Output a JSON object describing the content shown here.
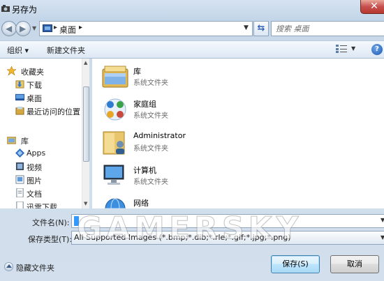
{
  "window": {
    "title": "另存为",
    "close_glyph": "✕"
  },
  "address": {
    "location": "桌面",
    "search_placeholder": "搜索 桌面"
  },
  "toolbar": {
    "organize": "组织 ▾",
    "new_folder": "新建文件夹",
    "help": "?"
  },
  "sidebar": {
    "favorites_header": "收藏夹",
    "favorites": [
      "下载",
      "桌面",
      "最近访问的位置"
    ],
    "libraries_header": "库",
    "libraries": [
      "Apps",
      "视频",
      "图片",
      "文档",
      "迅雷下载"
    ]
  },
  "files": [
    {
      "name": "库",
      "type": "系统文件夹",
      "icon": "library-folder-icon"
    },
    {
      "name": "家庭组",
      "type": "系统文件夹",
      "icon": "homegroup-icon"
    },
    {
      "name": "Administrator",
      "type": "系统文件夹",
      "icon": "user-folder-icon"
    },
    {
      "name": "计算机",
      "type": "系统文件夹",
      "icon": "computer-icon"
    },
    {
      "name": "网络",
      "type": "",
      "icon": "network-icon"
    }
  ],
  "form": {
    "filename_label": "文件名(N):",
    "filetype_label": "保存类型(T):",
    "filetype_value": "All Supported Images (*.bmp;*.dib;*.rle;*.gif;*.jpg;*.png)"
  },
  "footer": {
    "hide_folders": "隐藏文件夹",
    "save": "保存(S)",
    "cancel": "取消"
  },
  "watermark": "GAMERSKY",
  "colors": {
    "accent": "#3399ff",
    "close": "#c75050"
  }
}
